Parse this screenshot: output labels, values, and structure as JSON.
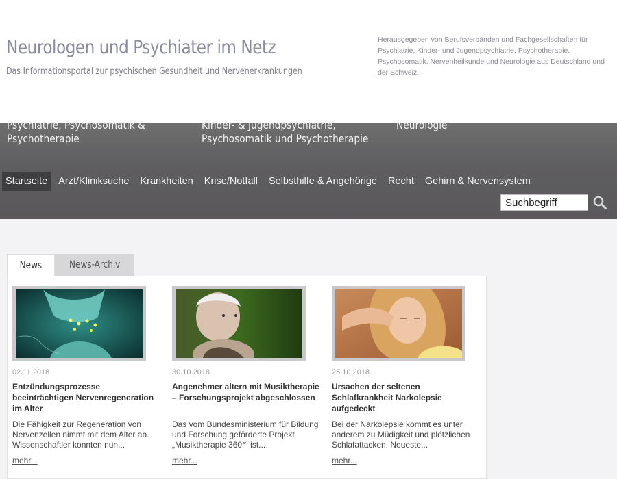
{
  "header": {
    "title": "Neurologen und Psychiater im Netz",
    "subtitle": "Das Informationsportal zur psychischen Gesundheit und Nervenerkrankungen",
    "publisher": "Herausgegeben von Berufsverbänden und Fachgesellschaften für Psychiatrie, Kinder- und Jugendpsychiatrie, Psychotherapie, Psychosomatik, Nervenheilkunde und Neurologie aus Deutschland und der Schweiz."
  },
  "categories": [
    {
      "line1": "Psychiatrie, Psychosomatik &",
      "line2": "Psychotherapie"
    },
    {
      "line1": "Kinder- & Jugendpsychiatrie,",
      "line2": "Psychosomatik und Psychotherapie"
    },
    {
      "line1": "Neurologie",
      "line2": ""
    }
  ],
  "nav": {
    "items": [
      "Startseite",
      "Arzt/Kliniksuche",
      "Krankheiten",
      "Krise/Notfall",
      "Selbsthilfe & Angehörige",
      "Recht",
      "Gehirn & Nervensystem"
    ],
    "active": "Startseite"
  },
  "search": {
    "value": "Suchbegriff",
    "icon": "magnifier-icon"
  },
  "tabs": [
    "News",
    "News-Archiv"
  ],
  "news": [
    {
      "image_icon": "synapse-image",
      "date": "02.11.2018",
      "title": "Entzündungsprozesse beeinträchtigen Nervenregeneration im Alter",
      "text": "Die Fähigkeit zur Regeneration von Nervenzellen nimmt mit dem Alter ab. Wissenschaftler konnten nun...",
      "more": "mehr..."
    },
    {
      "image_icon": "elderly-man-image",
      "date": "30.10.2018",
      "title": "Angenehmer altern mit Musiktherapie – Forschungsprojekt abgeschlossen",
      "text": "Das vom Bundesministerium für Bildung und Forschung geförderte Projekt „Musiktherapie 360°“ ist...",
      "more": "mehr..."
    },
    {
      "image_icon": "tired-woman-image",
      "date": "25.10.2018",
      "title": "Ursachen der seltenen Schlafkrankheit Narkolepsie aufgedeckt",
      "text": "Bei der Narkolepsie kommt es unter anderem zu Müdigkeit und plötzlichen Schlafattacken. Neueste...",
      "more": "mehr..."
    }
  ],
  "colors": {
    "band": "#5e5d5f",
    "nav_active": "#3e3d3f",
    "title": "#8a8c9c"
  }
}
